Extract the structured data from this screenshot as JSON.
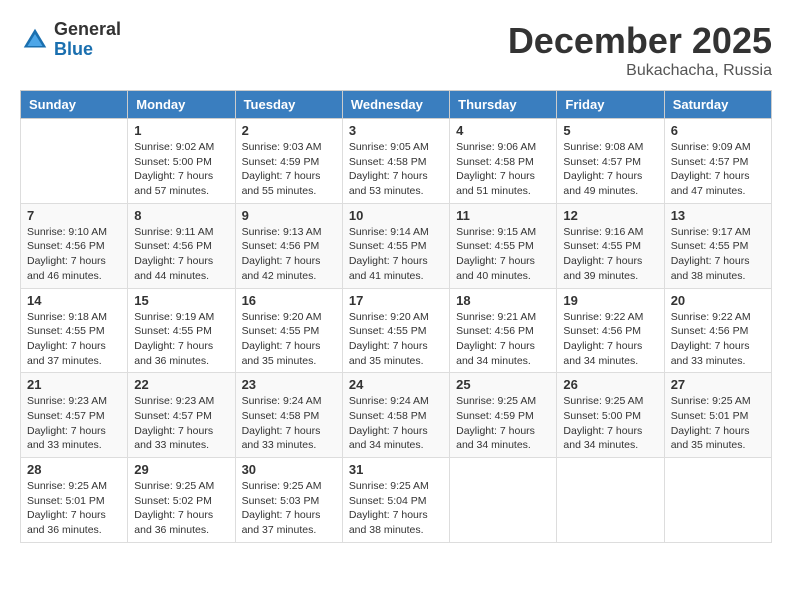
{
  "logo": {
    "general": "General",
    "blue": "Blue"
  },
  "header": {
    "month": "December 2025",
    "location": "Bukachacha, Russia"
  },
  "days_of_week": [
    "Sunday",
    "Monday",
    "Tuesday",
    "Wednesday",
    "Thursday",
    "Friday",
    "Saturday"
  ],
  "weeks": [
    [
      {
        "day": "",
        "info": ""
      },
      {
        "day": "1",
        "info": "Sunrise: 9:02 AM\nSunset: 5:00 PM\nDaylight: 7 hours\nand 57 minutes."
      },
      {
        "day": "2",
        "info": "Sunrise: 9:03 AM\nSunset: 4:59 PM\nDaylight: 7 hours\nand 55 minutes."
      },
      {
        "day": "3",
        "info": "Sunrise: 9:05 AM\nSunset: 4:58 PM\nDaylight: 7 hours\nand 53 minutes."
      },
      {
        "day": "4",
        "info": "Sunrise: 9:06 AM\nSunset: 4:58 PM\nDaylight: 7 hours\nand 51 minutes."
      },
      {
        "day": "5",
        "info": "Sunrise: 9:08 AM\nSunset: 4:57 PM\nDaylight: 7 hours\nand 49 minutes."
      },
      {
        "day": "6",
        "info": "Sunrise: 9:09 AM\nSunset: 4:57 PM\nDaylight: 7 hours\nand 47 minutes."
      }
    ],
    [
      {
        "day": "7",
        "info": "Sunrise: 9:10 AM\nSunset: 4:56 PM\nDaylight: 7 hours\nand 46 minutes."
      },
      {
        "day": "8",
        "info": "Sunrise: 9:11 AM\nSunset: 4:56 PM\nDaylight: 7 hours\nand 44 minutes."
      },
      {
        "day": "9",
        "info": "Sunrise: 9:13 AM\nSunset: 4:56 PM\nDaylight: 7 hours\nand 42 minutes."
      },
      {
        "day": "10",
        "info": "Sunrise: 9:14 AM\nSunset: 4:55 PM\nDaylight: 7 hours\nand 41 minutes."
      },
      {
        "day": "11",
        "info": "Sunrise: 9:15 AM\nSunset: 4:55 PM\nDaylight: 7 hours\nand 40 minutes."
      },
      {
        "day": "12",
        "info": "Sunrise: 9:16 AM\nSunset: 4:55 PM\nDaylight: 7 hours\nand 39 minutes."
      },
      {
        "day": "13",
        "info": "Sunrise: 9:17 AM\nSunset: 4:55 PM\nDaylight: 7 hours\nand 38 minutes."
      }
    ],
    [
      {
        "day": "14",
        "info": "Sunrise: 9:18 AM\nSunset: 4:55 PM\nDaylight: 7 hours\nand 37 minutes."
      },
      {
        "day": "15",
        "info": "Sunrise: 9:19 AM\nSunset: 4:55 PM\nDaylight: 7 hours\nand 36 minutes."
      },
      {
        "day": "16",
        "info": "Sunrise: 9:20 AM\nSunset: 4:55 PM\nDaylight: 7 hours\nand 35 minutes."
      },
      {
        "day": "17",
        "info": "Sunrise: 9:20 AM\nSunset: 4:55 PM\nDaylight: 7 hours\nand 35 minutes."
      },
      {
        "day": "18",
        "info": "Sunrise: 9:21 AM\nSunset: 4:56 PM\nDaylight: 7 hours\nand 34 minutes."
      },
      {
        "day": "19",
        "info": "Sunrise: 9:22 AM\nSunset: 4:56 PM\nDaylight: 7 hours\nand 34 minutes."
      },
      {
        "day": "20",
        "info": "Sunrise: 9:22 AM\nSunset: 4:56 PM\nDaylight: 7 hours\nand 33 minutes."
      }
    ],
    [
      {
        "day": "21",
        "info": "Sunrise: 9:23 AM\nSunset: 4:57 PM\nDaylight: 7 hours\nand 33 minutes."
      },
      {
        "day": "22",
        "info": "Sunrise: 9:23 AM\nSunset: 4:57 PM\nDaylight: 7 hours\nand 33 minutes."
      },
      {
        "day": "23",
        "info": "Sunrise: 9:24 AM\nSunset: 4:58 PM\nDaylight: 7 hours\nand 33 minutes."
      },
      {
        "day": "24",
        "info": "Sunrise: 9:24 AM\nSunset: 4:58 PM\nDaylight: 7 hours\nand 34 minutes."
      },
      {
        "day": "25",
        "info": "Sunrise: 9:25 AM\nSunset: 4:59 PM\nDaylight: 7 hours\nand 34 minutes."
      },
      {
        "day": "26",
        "info": "Sunrise: 9:25 AM\nSunset: 5:00 PM\nDaylight: 7 hours\nand 34 minutes."
      },
      {
        "day": "27",
        "info": "Sunrise: 9:25 AM\nSunset: 5:01 PM\nDaylight: 7 hours\nand 35 minutes."
      }
    ],
    [
      {
        "day": "28",
        "info": "Sunrise: 9:25 AM\nSunset: 5:01 PM\nDaylight: 7 hours\nand 36 minutes."
      },
      {
        "day": "29",
        "info": "Sunrise: 9:25 AM\nSunset: 5:02 PM\nDaylight: 7 hours\nand 36 minutes."
      },
      {
        "day": "30",
        "info": "Sunrise: 9:25 AM\nSunset: 5:03 PM\nDaylight: 7 hours\nand 37 minutes."
      },
      {
        "day": "31",
        "info": "Sunrise: 9:25 AM\nSunset: 5:04 PM\nDaylight: 7 hours\nand 38 minutes."
      },
      {
        "day": "",
        "info": ""
      },
      {
        "day": "",
        "info": ""
      },
      {
        "day": "",
        "info": ""
      }
    ]
  ]
}
